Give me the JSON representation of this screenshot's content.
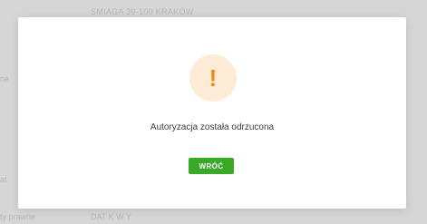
{
  "background": {
    "top_text": "SMIAGA 39-100 KRAKÓW",
    "left_text_1": "ne",
    "left_text_2": "at",
    "bottom_text_a": "ty prawne",
    "bottom_text_b": "DAT   K W   Y"
  },
  "modal": {
    "icon": "warning-exclamation-icon",
    "icon_glyph": "!",
    "message": "Autoryzacja została odrzucona",
    "button_label": "WRÓĆ"
  },
  "colors": {
    "accent_green": "#3aa928",
    "warning_orange": "#ef8a17",
    "warning_bg": "#fdebd6"
  }
}
